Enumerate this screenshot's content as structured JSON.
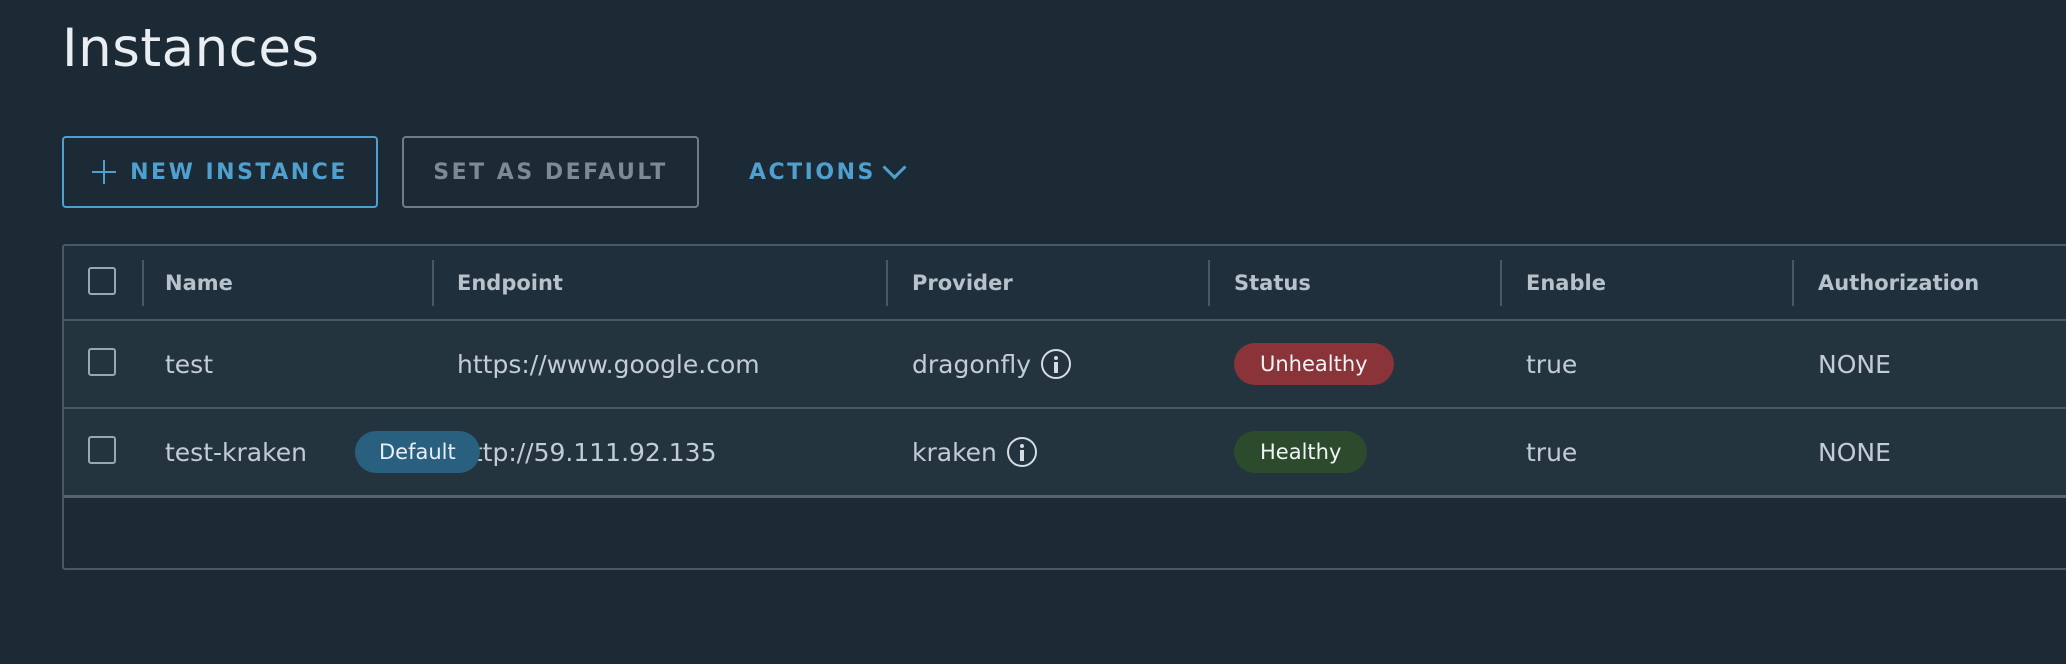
{
  "page": {
    "title": "Instances"
  },
  "toolbar": {
    "new_instance_label": "NEW INSTANCE",
    "set_default_label": "SET AS DEFAULT",
    "actions_label": "ACTIONS"
  },
  "colors": {
    "accent": "#4fa0cf",
    "unhealthy": "#8a3338",
    "healthy": "#2c4a2c",
    "default_badge": "#29607f",
    "background": "#1b2a35"
  },
  "icons": {
    "add": "plus-icon",
    "actions": "chevron-down-icon",
    "provider_info": "info-icon"
  },
  "table": {
    "columns": [
      "Name",
      "Endpoint",
      "Provider",
      "Status",
      "Enable",
      "Authorization"
    ],
    "rows": [
      {
        "name": "test",
        "endpoint": "https://www.google.com",
        "provider": "dragonfly",
        "status": "Unhealthy",
        "enable": "true",
        "authorization": "NONE",
        "default_label": ""
      },
      {
        "name": "test-kraken",
        "endpoint": "http://59.111.92.135",
        "provider": "kraken",
        "status": "Healthy",
        "enable": "true",
        "authorization": "NONE",
        "default_label": "Default"
      }
    ]
  }
}
